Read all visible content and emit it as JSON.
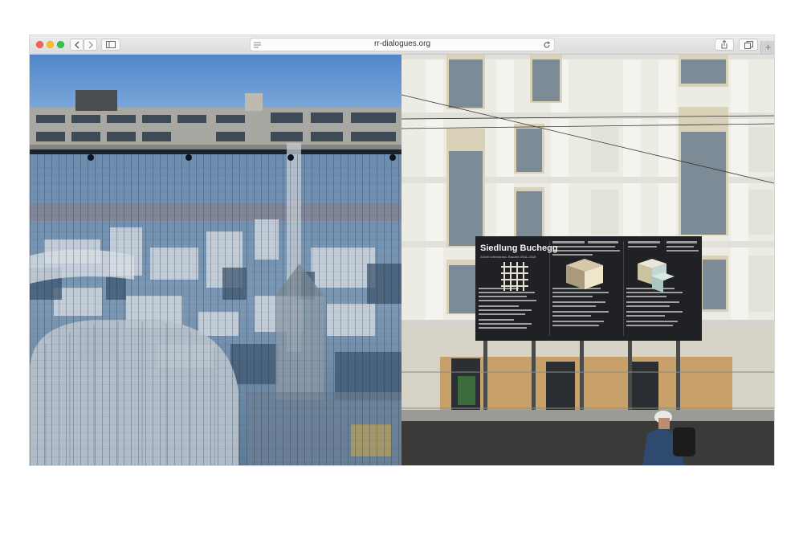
{
  "browser": {
    "url": "rr-dialogues.org",
    "back_icon": "chevron-left-icon",
    "forward_icon": "chevron-right-icon",
    "sidebar_icon": "sidebar-icon",
    "reader_icon": "reader-icon",
    "reload_icon": "reload-icon",
    "share_icon": "share-icon",
    "tabs_icon": "tabs-icon",
    "new_tab_label": "+"
  },
  "images": {
    "left": {
      "description_icon": "photo-rotterdam-fence"
    },
    "right": {
      "sign": {
        "title": "Siedlung Buchegg",
        "subtitle": "Zürich Unterstrass. Bauzeit 2016–2018"
      }
    }
  },
  "colors": {
    "sky": "#6f9ed4",
    "facade": "#ecebe4",
    "sign": "#1f2124"
  }
}
